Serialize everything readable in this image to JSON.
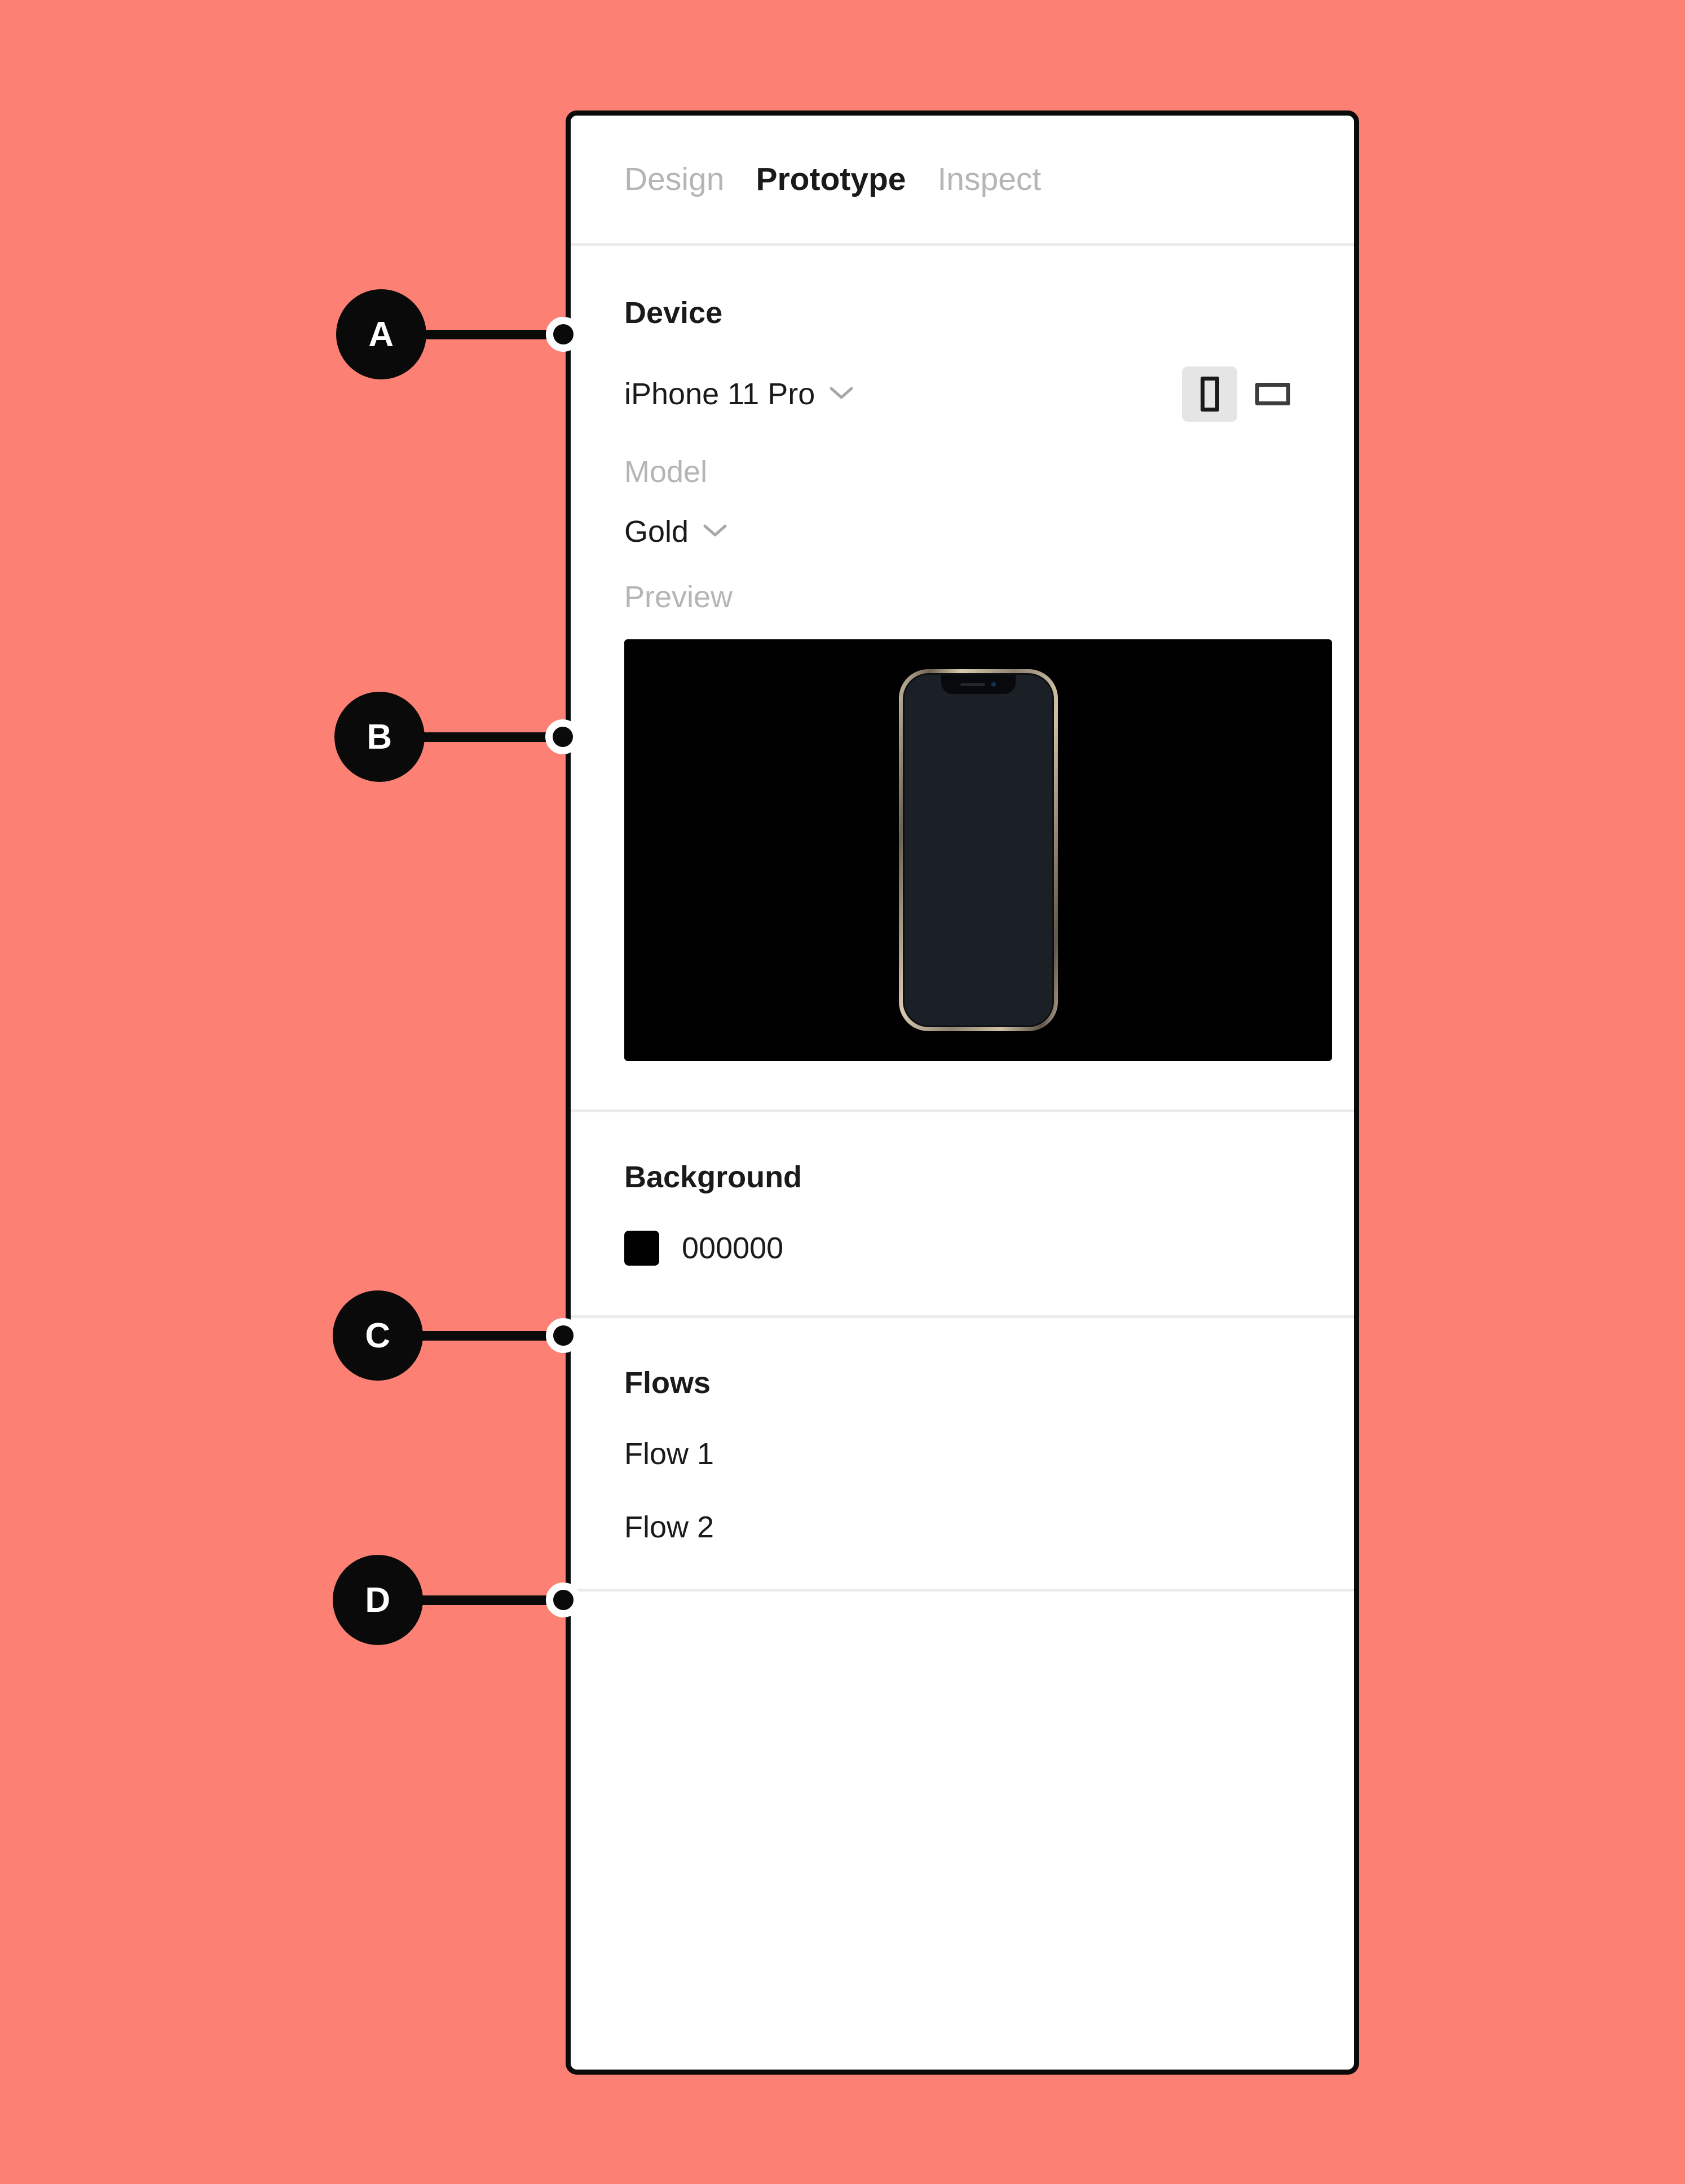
{
  "page": {
    "background_color": "#fc8174",
    "panel_border_color": "#0a0a0a",
    "divider_color": "#ebebeb"
  },
  "callouts": [
    {
      "label": "A",
      "target": "Device section heading"
    },
    {
      "label": "B",
      "target": "Preview section"
    },
    {
      "label": "C",
      "target": "Background section heading"
    },
    {
      "label": "D",
      "target": "Flows section heading"
    }
  ],
  "panel": {
    "tabs": [
      {
        "label": "Design",
        "active": false
      },
      {
        "label": "Prototype",
        "active": true
      },
      {
        "label": "Inspect",
        "active": false
      }
    ],
    "device_section": {
      "title": "Device",
      "device_value": "iPhone 11 Pro",
      "device_chevron_icon": "chevron-down-icon",
      "orientation": {
        "portrait_icon": "portrait-orientation-icon",
        "portrait_selected": true,
        "landscape_icon": "landscape-orientation-icon",
        "landscape_selected": false
      },
      "model_label": "Model",
      "model_value": "Gold",
      "model_chevron_icon": "chevron-down-icon",
      "preview_label": "Preview",
      "preview_background": "#000000",
      "preview_device": "iPhone 11 Pro Gold mockup"
    },
    "background_section": {
      "title": "Background",
      "swatch_color": "#000000",
      "hex_value": "000000"
    },
    "flows_section": {
      "title": "Flows",
      "flows": [
        {
          "label": "Flow 1"
        },
        {
          "label": "Flow 2"
        }
      ]
    }
  }
}
